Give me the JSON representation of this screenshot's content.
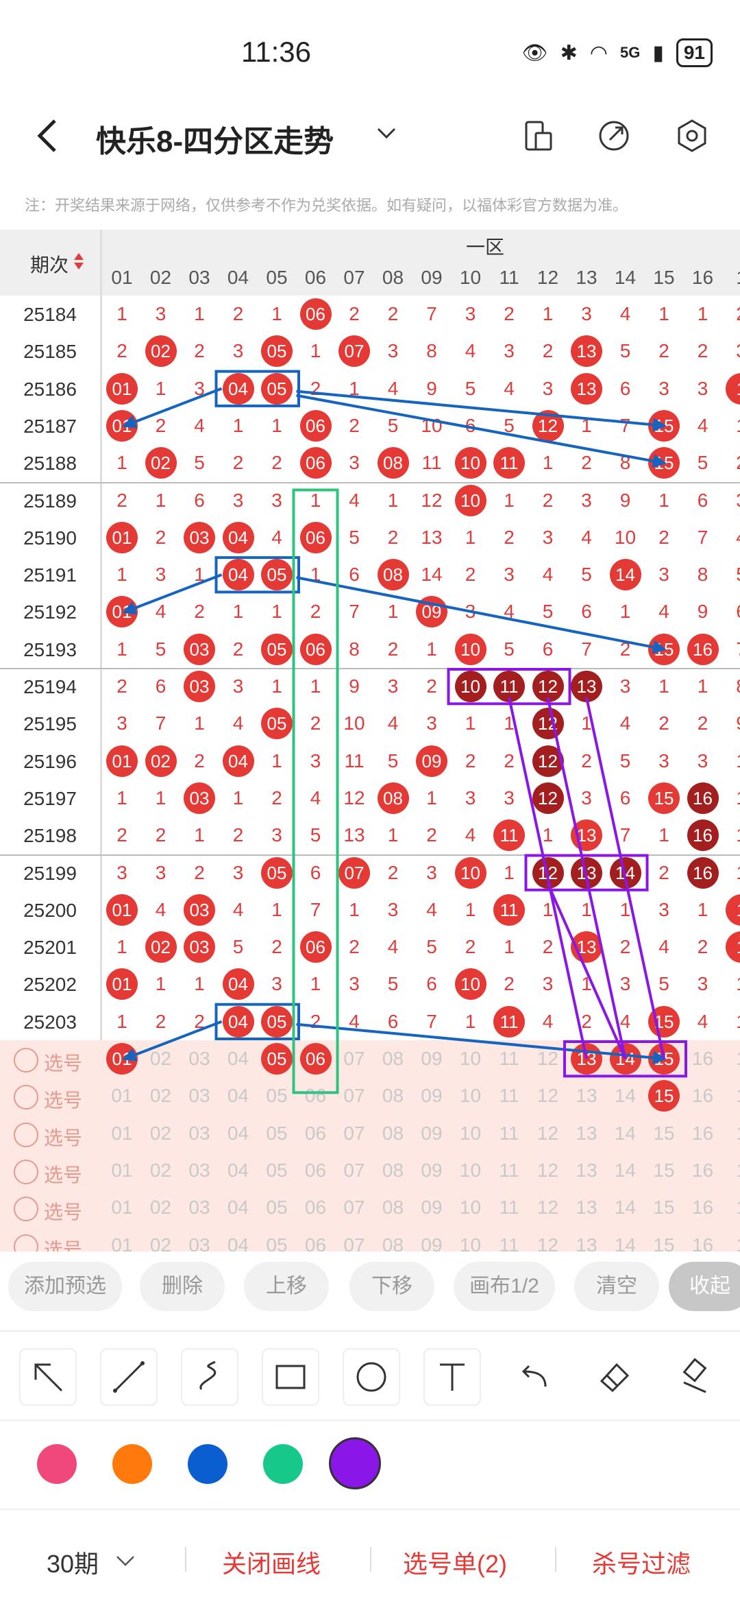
{
  "status_bar": {
    "time": "11:36",
    "network": "5G",
    "battery": "91"
  },
  "header": {
    "title": "快乐8-四分区走势"
  },
  "note": "注：开奖结果来源于网络，仅供参考不作为兑奖依据。如有疑问，以福体彩官方数据为准。",
  "table": {
    "issue_header": "期次",
    "zone_label": "一区",
    "columns": [
      "01",
      "02",
      "03",
      "04",
      "05",
      "06",
      "07",
      "08",
      "09",
      "10",
      "11",
      "12",
      "13",
      "14",
      "15",
      "16",
      "1"
    ],
    "rows": [
      {
        "issue": "25184",
        "cells": [
          "1",
          "3",
          "1",
          "2",
          "1",
          "06",
          "2",
          "2",
          "7",
          "3",
          "2",
          "1",
          "3",
          "4",
          "1",
          "1",
          "2"
        ],
        "balls": [
          5
        ]
      },
      {
        "issue": "25185",
        "cells": [
          "2",
          "02",
          "2",
          "3",
          "05",
          "1",
          "07",
          "3",
          "8",
          "4",
          "3",
          "2",
          "13",
          "5",
          "2",
          "2",
          "3"
        ],
        "balls": [
          1,
          4,
          6,
          12
        ]
      },
      {
        "issue": "25186",
        "cells": [
          "01",
          "1",
          "3",
          "04",
          "05",
          "2",
          "1",
          "4",
          "9",
          "5",
          "4",
          "3",
          "13",
          "6",
          "3",
          "3",
          "1"
        ],
        "balls": [
          0,
          3,
          4,
          12,
          16
        ]
      },
      {
        "issue": "25187",
        "cells": [
          "01",
          "2",
          "4",
          "1",
          "1",
          "06",
          "2",
          "5",
          "10",
          "6",
          "5",
          "12",
          "1",
          "7",
          "15",
          "4",
          "1"
        ],
        "balls": [
          0,
          5,
          11,
          14
        ]
      },
      {
        "issue": "25188",
        "cells": [
          "1",
          "02",
          "5",
          "2",
          "2",
          "06",
          "3",
          "08",
          "11",
          "10",
          "11",
          "1",
          "2",
          "8",
          "15",
          "5",
          "2"
        ],
        "balls": [
          1,
          5,
          7,
          9,
          10,
          14
        ]
      },
      {
        "issue": "25189",
        "cells": [
          "2",
          "1",
          "6",
          "3",
          "3",
          "1",
          "4",
          "1",
          "12",
          "10",
          "1",
          "2",
          "3",
          "9",
          "1",
          "6",
          "3"
        ],
        "balls": [
          9
        ]
      },
      {
        "issue": "25190",
        "cells": [
          "01",
          "2",
          "03",
          "04",
          "4",
          "06",
          "5",
          "2",
          "13",
          "1",
          "2",
          "3",
          "4",
          "10",
          "2",
          "7",
          "4"
        ],
        "balls": [
          0,
          2,
          3,
          5
        ]
      },
      {
        "issue": "25191",
        "cells": [
          "1",
          "3",
          "1",
          "04",
          "05",
          "1",
          "6",
          "08",
          "14",
          "2",
          "3",
          "4",
          "5",
          "14",
          "3",
          "8",
          "5"
        ],
        "balls": [
          3,
          4,
          7,
          13
        ]
      },
      {
        "issue": "25192",
        "cells": [
          "01",
          "4",
          "2",
          "1",
          "1",
          "2",
          "7",
          "1",
          "09",
          "3",
          "4",
          "5",
          "6",
          "1",
          "4",
          "9",
          "6"
        ],
        "balls": [
          0,
          8
        ]
      },
      {
        "issue": "25193",
        "cells": [
          "1",
          "5",
          "03",
          "2",
          "05",
          "06",
          "8",
          "2",
          "1",
          "10",
          "5",
          "6",
          "7",
          "2",
          "15",
          "16",
          "7"
        ],
        "balls": [
          2,
          4,
          5,
          9,
          14,
          15
        ]
      },
      {
        "issue": "25194",
        "cells": [
          "2",
          "6",
          "03",
          "3",
          "1",
          "1",
          "9",
          "3",
          "2",
          "10",
          "11",
          "12",
          "13",
          "3",
          "1",
          "1",
          "8"
        ],
        "balls": [
          2
        ],
        "dark": [
          9,
          10,
          11,
          12
        ]
      },
      {
        "issue": "25195",
        "cells": [
          "3",
          "7",
          "1",
          "4",
          "05",
          "2",
          "10",
          "4",
          "3",
          "1",
          "1",
          "12",
          "1",
          "4",
          "2",
          "2",
          "9"
        ],
        "balls": [
          4
        ],
        "dark": [
          11
        ]
      },
      {
        "issue": "25196",
        "cells": [
          "01",
          "02",
          "2",
          "04",
          "1",
          "3",
          "11",
          "5",
          "09",
          "2",
          "2",
          "12",
          "2",
          "5",
          "3",
          "3",
          "1"
        ],
        "balls": [
          0,
          1,
          3,
          8
        ],
        "dark": [
          11
        ]
      },
      {
        "issue": "25197",
        "cells": [
          "1",
          "1",
          "03",
          "1",
          "2",
          "4",
          "12",
          "08",
          "1",
          "3",
          "3",
          "12",
          "3",
          "6",
          "15",
          "16",
          "1"
        ],
        "balls": [
          2,
          7,
          14
        ],
        "dark": [
          11,
          15
        ]
      },
      {
        "issue": "25198",
        "cells": [
          "2",
          "2",
          "1",
          "2",
          "3",
          "5",
          "13",
          "1",
          "2",
          "4",
          "11",
          "1",
          "13",
          "7",
          "1",
          "16",
          "1"
        ],
        "balls": [
          10,
          12
        ],
        "dark": [
          15
        ]
      },
      {
        "issue": "25199",
        "cells": [
          "3",
          "3",
          "2",
          "3",
          "05",
          "6",
          "07",
          "2",
          "3",
          "10",
          "1",
          "12",
          "13",
          "14",
          "2",
          "16",
          "1"
        ],
        "balls": [
          4,
          6,
          9
        ],
        "dark": [
          11,
          12,
          13,
          15
        ]
      },
      {
        "issue": "25200",
        "cells": [
          "01",
          "4",
          "03",
          "4",
          "1",
          "7",
          "1",
          "3",
          "4",
          "1",
          "11",
          "1",
          "1",
          "1",
          "3",
          "1",
          "1"
        ],
        "balls": [
          0,
          2,
          10,
          16
        ]
      },
      {
        "issue": "25201",
        "cells": [
          "1",
          "02",
          "03",
          "5",
          "2",
          "06",
          "2",
          "4",
          "5",
          "2",
          "1",
          "2",
          "13",
          "2",
          "4",
          "2",
          "1"
        ],
        "balls": [
          1,
          2,
          5,
          12,
          16
        ]
      },
      {
        "issue": "25202",
        "cells": [
          "01",
          "1",
          "1",
          "04",
          "3",
          "1",
          "3",
          "5",
          "6",
          "10",
          "2",
          "3",
          "1",
          "3",
          "5",
          "3",
          "1"
        ],
        "balls": [
          0,
          3,
          9
        ]
      },
      {
        "issue": "25203",
        "cells": [
          "1",
          "2",
          "2",
          "04",
          "05",
          "2",
          "4",
          "6",
          "7",
          "1",
          "11",
          "4",
          "2",
          "4",
          "15",
          "4",
          "1"
        ],
        "balls": [
          3,
          4,
          10,
          14
        ]
      }
    ],
    "pick_label": "选号",
    "pick_rows": [
      {
        "cells": [
          "01",
          "02",
          "03",
          "04",
          "05",
          "06",
          "07",
          "08",
          "09",
          "10",
          "11",
          "12",
          "13",
          "14",
          "15",
          "16",
          "1"
        ],
        "balls": [
          0,
          4,
          5,
          12,
          13,
          14
        ]
      },
      {
        "cells": [
          "01",
          "02",
          "03",
          "04",
          "05",
          "06",
          "07",
          "08",
          "09",
          "10",
          "11",
          "12",
          "13",
          "14",
          "15",
          "16",
          "1"
        ],
        "balls": [
          14
        ]
      },
      {
        "cells": [
          "01",
          "02",
          "03",
          "04",
          "05",
          "06",
          "07",
          "08",
          "09",
          "10",
          "11",
          "12",
          "13",
          "14",
          "15",
          "16",
          "1"
        ],
        "balls": []
      },
      {
        "cells": [
          "01",
          "02",
          "03",
          "04",
          "05",
          "06",
          "07",
          "08",
          "09",
          "10",
          "11",
          "12",
          "13",
          "14",
          "15",
          "16",
          "1"
        ],
        "balls": []
      },
      {
        "cells": [
          "01",
          "02",
          "03",
          "04",
          "05",
          "06",
          "07",
          "08",
          "09",
          "10",
          "11",
          "12",
          "13",
          "14",
          "15",
          "16",
          "1"
        ],
        "balls": []
      },
      {
        "cells": [
          "01",
          "02",
          "03",
          "04",
          "05",
          "06",
          "07",
          "08",
          "09",
          "10",
          "11",
          "12",
          "13",
          "14",
          "15",
          "16",
          "1"
        ],
        "balls": []
      }
    ]
  },
  "actions": {
    "add": "添加预选",
    "delete": "删除",
    "up": "上移",
    "down": "下移",
    "canvas": "画布1/2",
    "clear": "清空",
    "collapse": "收起"
  },
  "tools": [
    "select-arrow-icon",
    "line-icon",
    "curve-icon",
    "rectangle-icon",
    "circle-icon",
    "text-icon",
    "undo-icon",
    "eraser-icon",
    "clear-canvas-icon"
  ],
  "colors": [
    "#f0487a",
    "#ff7a0a",
    "#0a5ecf",
    "#16c98a",
    "#8a16e8"
  ],
  "bottom": {
    "periods": "30期",
    "close_draw": "关闭画线",
    "pick_list": "选号单(2)",
    "filter": "杀号过滤"
  }
}
